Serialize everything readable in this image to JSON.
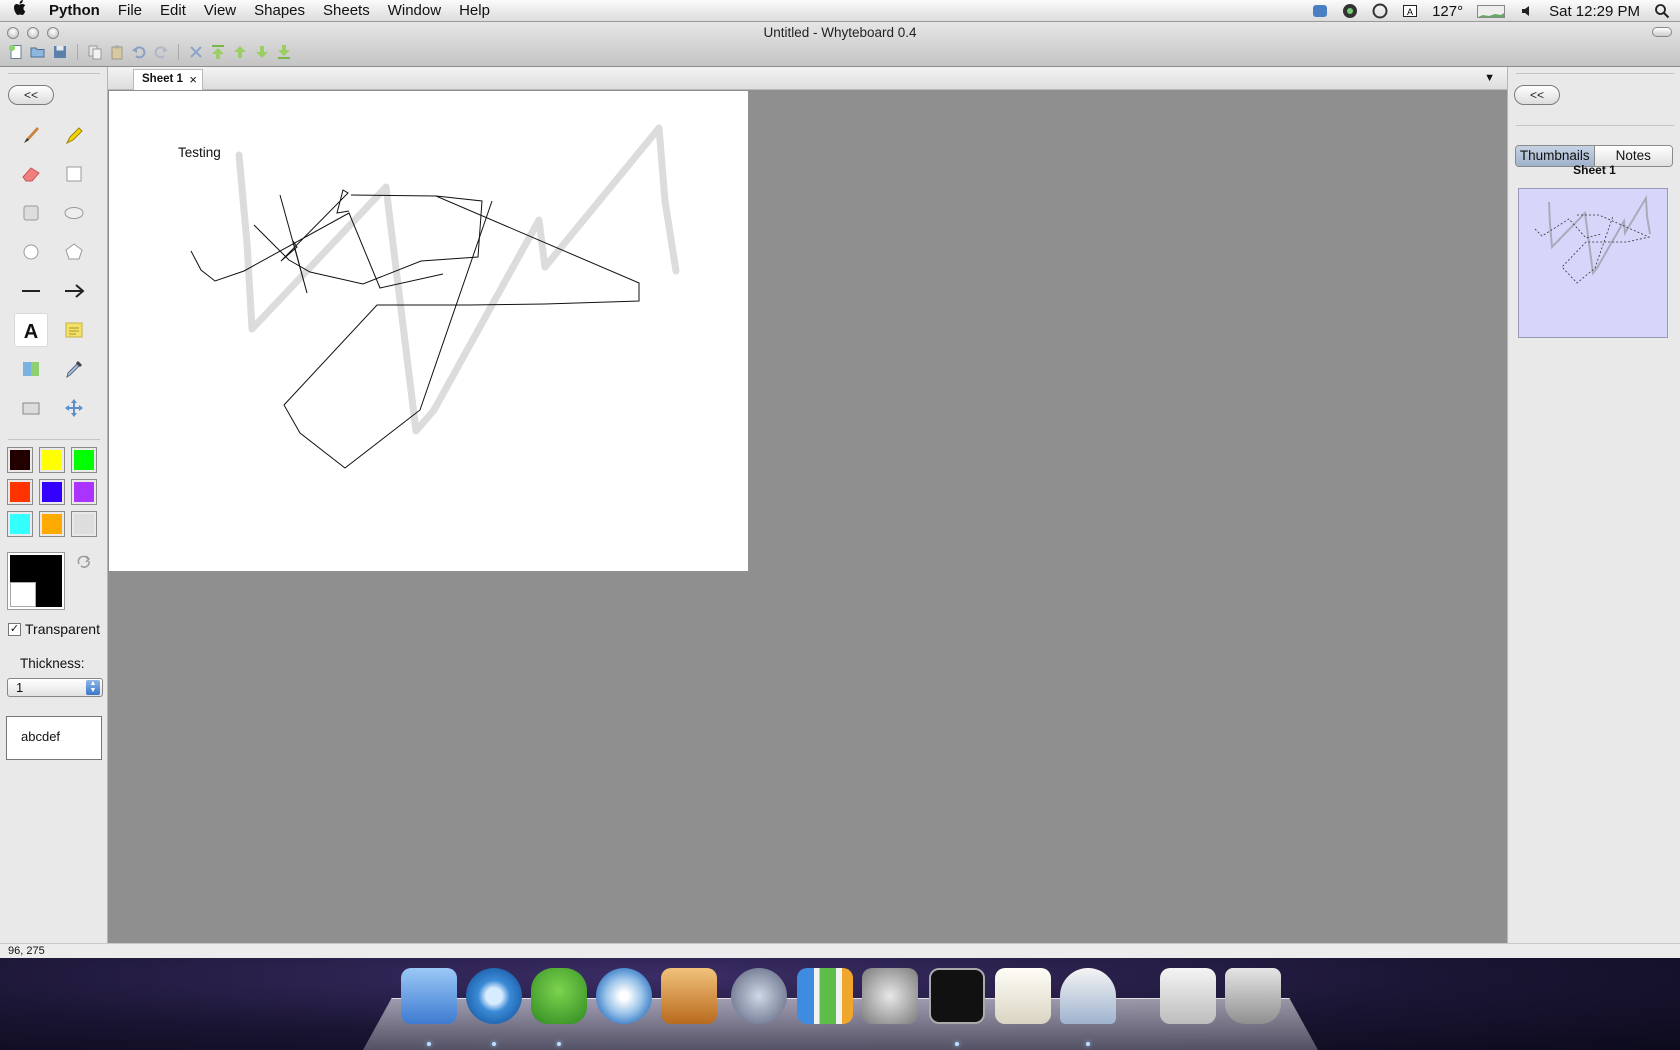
{
  "menubar": {
    "app": "Python",
    "items": [
      "File",
      "Edit",
      "View",
      "Shapes",
      "Sheets",
      "Window",
      "Help"
    ],
    "temperature": "127°",
    "clock": "Sat 12:29 PM"
  },
  "window": {
    "title": "Untitled - Whyteboard 0.4"
  },
  "left_panel": {
    "collapse_label": "<<",
    "tools": [
      "pen",
      "highlighter",
      "eraser",
      "rectangle",
      "rounded-rectangle",
      "ellipse",
      "circle",
      "polygon",
      "line",
      "arrow",
      "text",
      "note",
      "bitmap-select",
      "eyedropper",
      "image",
      "move"
    ],
    "selected_tool": "text",
    "palette": [
      "#220000",
      "#ffff00",
      "#00ff00",
      "#ff3300",
      "#3300ff",
      "#aa33ff",
      "#33ffff",
      "#ffaa00",
      "#dddddd"
    ],
    "foreground": "#000000",
    "background": "#ffffff",
    "transparent_label": "Transparent",
    "transparent_checked": true,
    "thickness_label": "Thickness:",
    "thickness_value": "1",
    "font_preview": "abcdef"
  },
  "tabs": [
    {
      "label": "Sheet 1",
      "close": "×"
    }
  ],
  "canvas": {
    "text": "Testing"
  },
  "right_panel": {
    "collapse_label": "<<",
    "segments": [
      "Thumbnails",
      "Notes"
    ],
    "active_segment": "Thumbnails",
    "thumb_title": "Sheet 1"
  },
  "status": {
    "coords": "96, 275"
  },
  "dock": {
    "apps": [
      "finder-icon",
      "chromium-icon",
      "adium-icon",
      "itunes-icon",
      "keynote-icon",
      "script-editor-icon",
      "numbers-icon",
      "system-preferences-icon",
      "terminal-icon",
      "textedit-icon",
      "python-launcher-icon",
      "downloads-stack-icon",
      "trash-icon"
    ]
  }
}
